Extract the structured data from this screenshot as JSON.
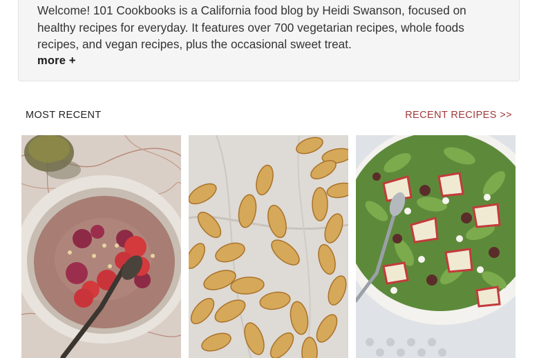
{
  "intro": {
    "text": "Welcome! 101 Cookbooks is a California food blog by Heidi Swanson, focused on healthy recipes for everyday. It features over 700 vegetarian recipes, whole foods recipes, and vegan recipes, plus the occasional sweet treat.",
    "more_label": "more +"
  },
  "recent": {
    "title": "MOST RECENT",
    "link_label": "RECENT RECIPES >>",
    "link_color": "#a0393a"
  },
  "photos": [
    {
      "subject": "smoothie-bowl-with-raspberries-photo"
    },
    {
      "subject": "toasted-pumpkin-seeds-photo"
    },
    {
      "subject": "apple-salad-photo"
    }
  ]
}
